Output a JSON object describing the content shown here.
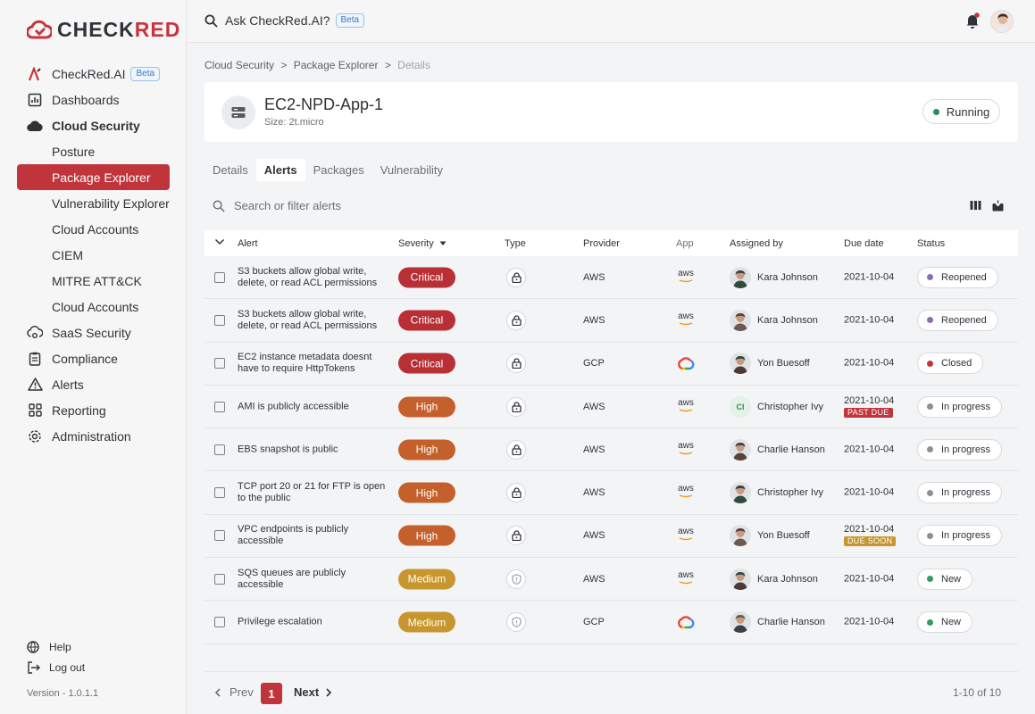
{
  "brand": {
    "prefix": "CHECK",
    "suffix": "RED",
    "color": "#c8343c"
  },
  "sidebar": {
    "items": [
      {
        "label": "CheckRed.AI",
        "badge": "Beta"
      },
      {
        "label": "Dashboards"
      },
      {
        "label": "Cloud Security"
      },
      {
        "label": "Posture"
      },
      {
        "label": "Package Explorer"
      },
      {
        "label": "Vulnerability Explorer"
      },
      {
        "label": "Cloud Accounts"
      },
      {
        "label": "CIEM"
      },
      {
        "label": "MITRE ATT&CK"
      },
      {
        "label": "Cloud Accounts"
      },
      {
        "label": "SaaS Security"
      },
      {
        "label": "Compliance"
      },
      {
        "label": "Alerts"
      },
      {
        "label": "Reporting"
      },
      {
        "label": "Administration"
      }
    ],
    "help": "Help",
    "logout": "Log out",
    "version": "Version - 1.0.1.1"
  },
  "topbar": {
    "ask_label": "Ask CheckRed.AI?",
    "ask_badge": "Beta"
  },
  "breadcrumb": {
    "a": "Cloud Security",
    "b": "Package Explorer",
    "c": "Details",
    "sep": ">"
  },
  "resource": {
    "name": "EC2-NPD-App-1",
    "size": "Size: 2t.micro",
    "status": "Running"
  },
  "tabs": [
    "Details",
    "Alerts",
    "Packages",
    "Vulnerability"
  ],
  "search": {
    "placeholder": "Search or filter alerts"
  },
  "table": {
    "headers": {
      "alert": "Alert",
      "severity": "Severity",
      "type": "Type",
      "provider": "Provider",
      "app": "App",
      "assigned": "Assigned by",
      "due": "Due date",
      "status": "Status"
    },
    "rows": [
      {
        "alert": "S3 buckets allow global write, delete, or read ACL permissions",
        "severity": "Critical",
        "provider": "AWS",
        "assignee": "Kara Johnson",
        "due": "2021-10-04",
        "flag": "",
        "status": "Reopened"
      },
      {
        "alert": "S3 buckets allow global write, delete, or read ACL permissions",
        "severity": "Critical",
        "provider": "AWS",
        "assignee": "Kara Johnson",
        "due": "2021-10-04",
        "flag": "",
        "status": "Reopened"
      },
      {
        "alert": "EC2 instance metadata doesnt have to require HttpTokens",
        "severity": "Critical",
        "provider": "GCP",
        "assignee": "Yon Buesoff",
        "due": "2021-10-04",
        "flag": "",
        "status": "Closed"
      },
      {
        "alert": "AMI is publicly accessible",
        "severity": "High",
        "provider": "AWS",
        "assignee": "Christopher Ivy",
        "initials": "CI",
        "due": "2021-10-04",
        "flag": "PAST DUE",
        "status": "In progress"
      },
      {
        "alert": "EBS snapshot is public",
        "severity": "High",
        "provider": "AWS",
        "assignee": "Charlie Hanson",
        "due": "2021-10-04",
        "flag": "",
        "status": "In progress"
      },
      {
        "alert": "TCP port 20 or 21 for FTP is open to the public",
        "severity": "High",
        "provider": "AWS",
        "assignee": "Christopher Ivy",
        "due": "2021-10-04",
        "flag": "",
        "status": "In progress"
      },
      {
        "alert": "VPC endpoints is publicly accessible",
        "severity": "High",
        "provider": "AWS",
        "assignee": "Yon Buesoff",
        "due": "2021-10-04",
        "flag": "DUE SOON",
        "status": "In progress"
      },
      {
        "alert": "SQS queues are publicly accessible",
        "severity": "Medium",
        "provider": "AWS",
        "assignee": "Kara Johnson",
        "due": "2021-10-04",
        "flag": "",
        "status": "New"
      },
      {
        "alert": "Privilege escalation",
        "severity": "Medium",
        "provider": "GCP",
        "assignee": "Charlie Hanson",
        "due": "2021-10-04",
        "flag": "",
        "status": "New"
      }
    ]
  },
  "pager": {
    "prev": "Prev",
    "page": "1",
    "next": "Next",
    "count": "1-10 of 10"
  },
  "aws_logo_text": "aws"
}
